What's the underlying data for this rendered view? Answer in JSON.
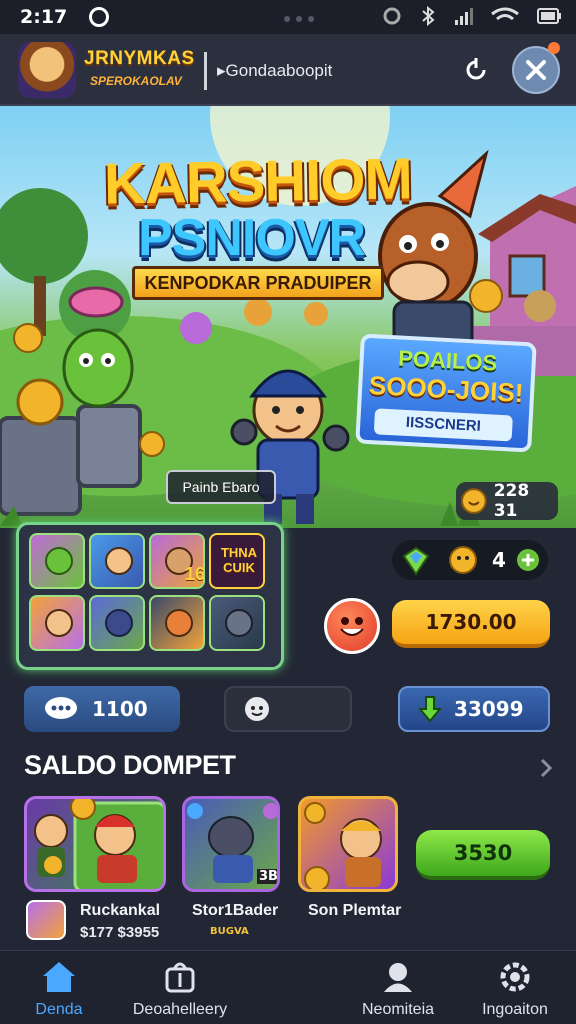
{
  "status_bar": {
    "time": "2:17"
  },
  "header": {
    "app_name": "JRNYMKAS",
    "app_subtitle": "SPEROKAOLAV",
    "url": "▸Gondaaboopit"
  },
  "hero": {
    "title_line1": "KARSHIOM",
    "title_line2": "PSNIOVR",
    "ribbon": "KENPODKAR PRADUIPER",
    "promo_line1": "POAILOS",
    "promo_line2": "SOOO-JOIS!",
    "promo_button": "IISSCNERI",
    "caption": "Painb Ebaro",
    "coin_value": "228 31"
  },
  "game_panel": {
    "tiles": [
      "",
      "",
      "",
      "THNA CUIK",
      "",
      "",
      "",
      ""
    ],
    "tile16_label": "16"
  },
  "level": {
    "value": "4"
  },
  "price_button": "1730.00",
  "stats": {
    "stat1": "1100",
    "stat2": "",
    "stat3": "33099"
  },
  "section_title": "SALDO DOMPET",
  "cards": {
    "card2_tag": "3B"
  },
  "buy_button": "3530",
  "items": [
    {
      "name": "Ruckankal",
      "price": "$177 $3955"
    },
    {
      "name": "Stor1Bader",
      "sub": "BUGVA"
    },
    {
      "name": "Son Plemtar"
    }
  ],
  "nav": [
    {
      "label": "Denda",
      "icon": "home-icon",
      "active": true
    },
    {
      "label": "Deoahelleery",
      "icon": "bag-icon",
      "active": false
    },
    {
      "label": "Neomiteia",
      "icon": "profile-icon",
      "active": false
    },
    {
      "label": "Ingoaiton",
      "icon": "settings-icon",
      "active": false
    }
  ],
  "colors": {
    "background": "#232735",
    "accent_yellow": "#ffd34a",
    "accent_green": "#8ee84a",
    "accent_blue": "#4aa8ff"
  }
}
